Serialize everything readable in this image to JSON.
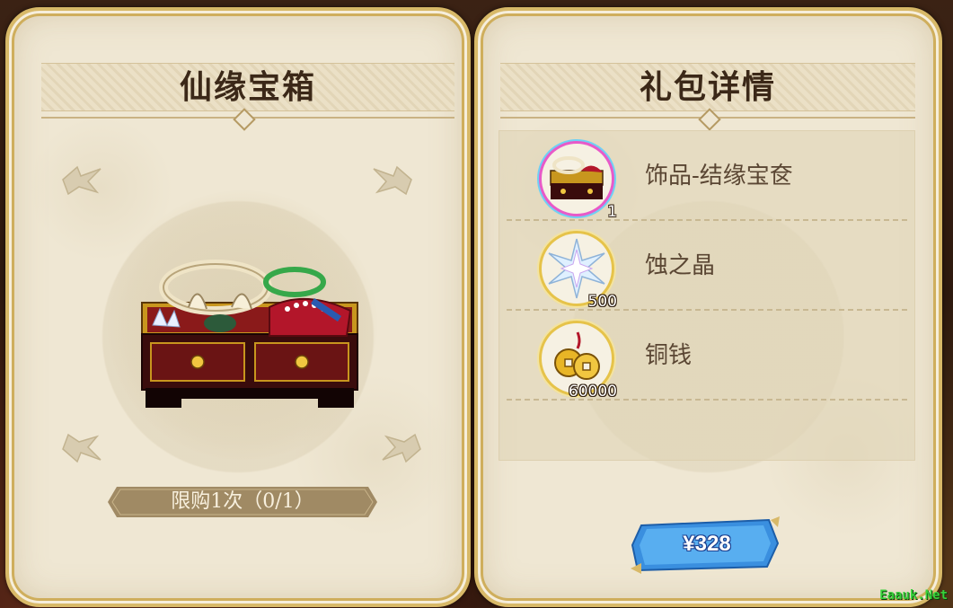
{
  "left_panel": {
    "title": "仙缘宝箱",
    "limit_text": "限购1次（0/1）",
    "item_icon": "jewelry-chest-icon"
  },
  "right_panel": {
    "title": "礼包详情",
    "rewards": [
      {
        "name": "饰品-结缘宝奁",
        "quantity": "1",
        "icon": "jewelry-chest-icon"
      },
      {
        "name": "蚀之晶",
        "quantity": "500",
        "icon": "crystal-star-icon"
      },
      {
        "name": "铜钱",
        "quantity": "60000",
        "icon": "copper-coins-icon"
      }
    ],
    "price_label": "¥328"
  },
  "watermark": "Eaauk.Net",
  "colors": {
    "panel_bg": "#efe7d3",
    "gold_border": "#d8b968",
    "title_text": "#3b2818",
    "banner_bg": "#a08a64",
    "price_button": "#3a8fdf"
  }
}
